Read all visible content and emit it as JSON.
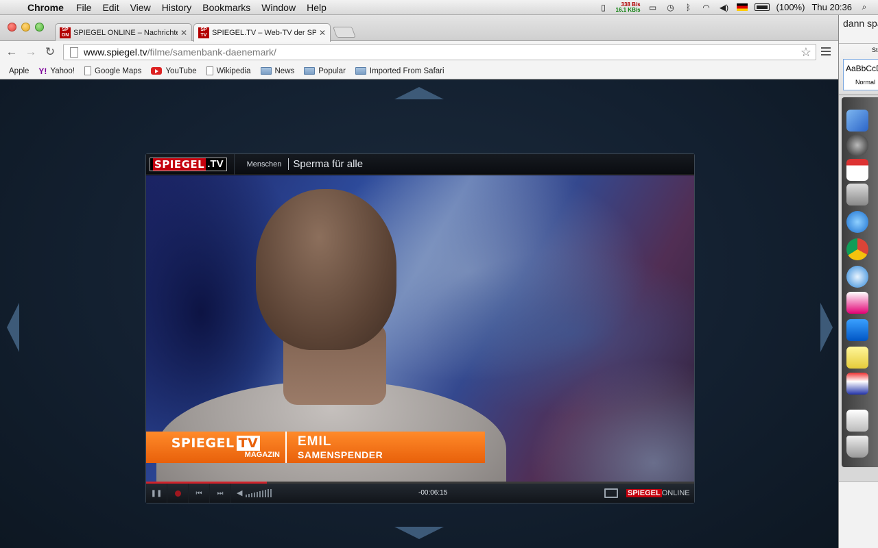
{
  "menubar": {
    "app_name": "Chrome",
    "items": [
      "File",
      "Edit",
      "View",
      "History",
      "Bookmarks",
      "Window",
      "Help"
    ],
    "net_up": "338 B/s",
    "net_down": "16.1 KB/s",
    "battery": "(100%)",
    "clock": "Thu 20:36"
  },
  "tabs": [
    {
      "title": "SPIEGEL ONLINE – Nachrichten",
      "favicon": "SP ON"
    },
    {
      "title": "SPIEGEL.TV – Web-TV der SPIEGEL",
      "favicon": "SP TV"
    }
  ],
  "address_bar": {
    "host": "www.spiegel.tv",
    "path": "/filme/samenbank-daenemark/"
  },
  "bookmarks": [
    {
      "label": "Apple",
      "icon": "apple-icon"
    },
    {
      "label": "Yahoo!",
      "icon": "yahoo-icon"
    },
    {
      "label": "Google Maps",
      "icon": "page-icon"
    },
    {
      "label": "YouTube",
      "icon": "youtube-icon"
    },
    {
      "label": "Wikipedia",
      "icon": "page-icon"
    },
    {
      "label": "News",
      "icon": "folder-icon"
    },
    {
      "label": "Popular",
      "icon": "folder-icon"
    },
    {
      "label": "Imported From Safari",
      "icon": "folder-icon"
    }
  ],
  "player": {
    "logo_red": "SPIEGEL",
    "logo_tv": ".TV",
    "category": "Menschen",
    "title": "Sperma für alle",
    "lower_third": {
      "logo": "SPIEGEL",
      "logo_tv": "TV",
      "logo_sub": "MAGAZIN",
      "name": "EMIL",
      "role": "SAMENSPENDER"
    },
    "time": "-00:06:15",
    "progress": 0.22,
    "footer_logo_red": "SPIEGEL",
    "footer_logo_rest": "ONLINE"
  },
  "side": {
    "top_text": "dann spa",
    "style_sample": "AaBbCcD",
    "style_name": "Normal",
    "tab_label": "St"
  },
  "colors": {
    "accent_red": "#c4000d",
    "lower_third_orange": "#e8600a",
    "page_bg": "#132030",
    "nav_arrow": "#3d5a78"
  }
}
